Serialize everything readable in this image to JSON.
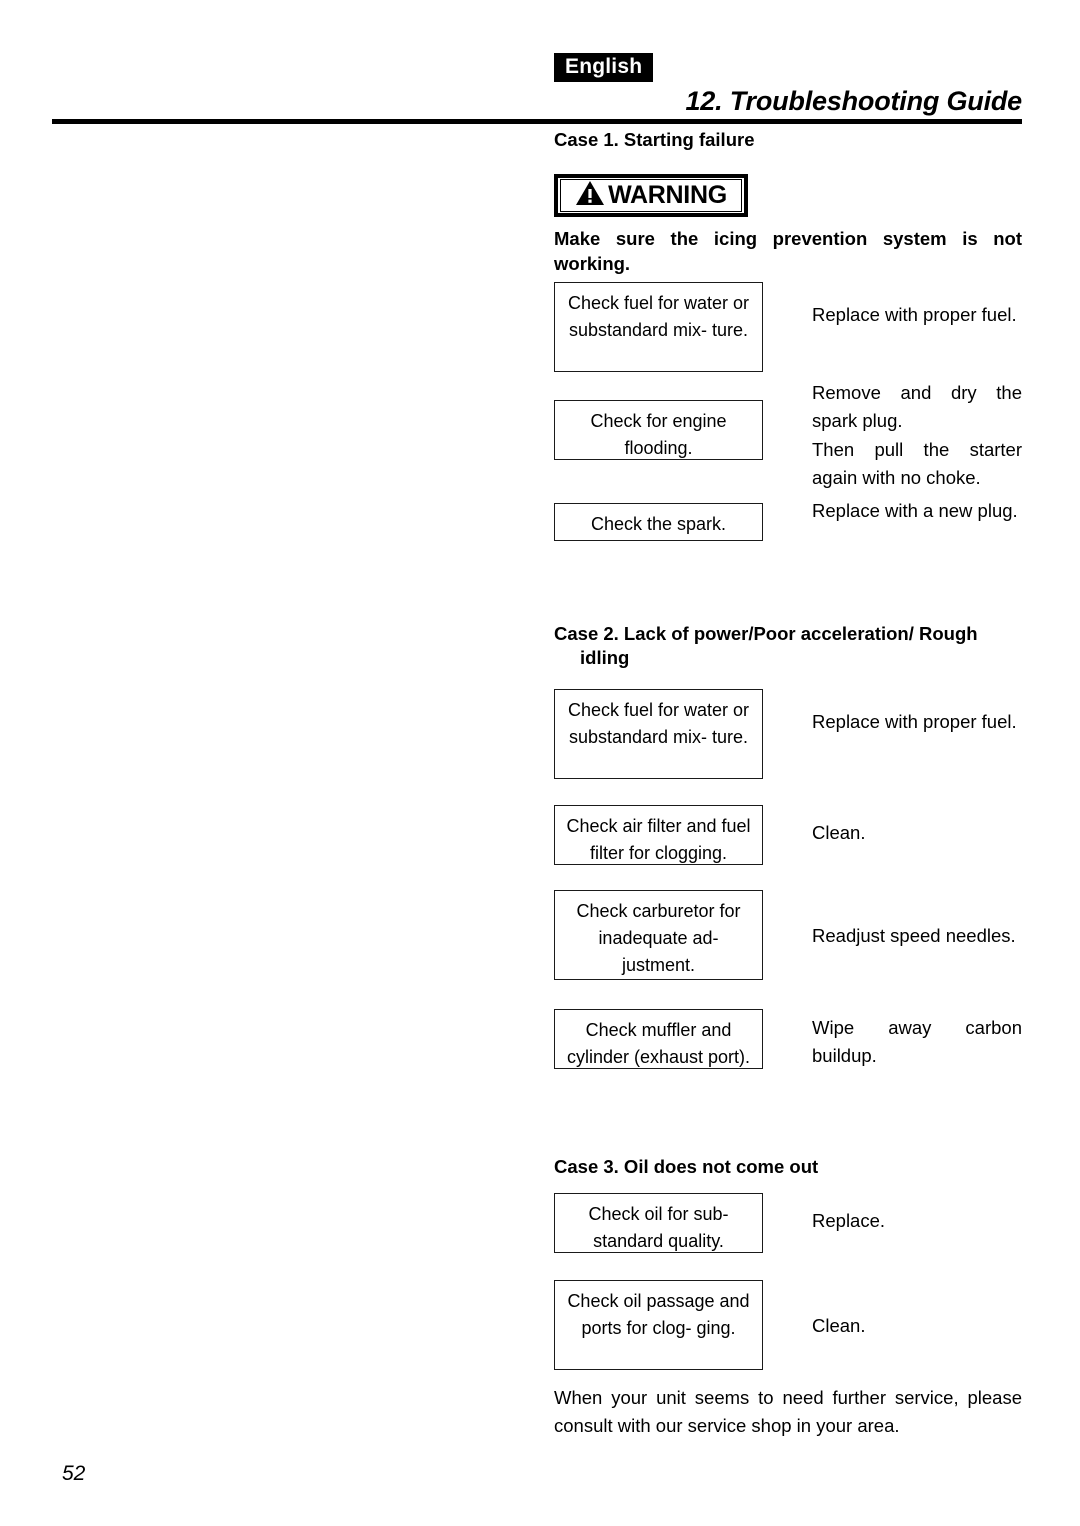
{
  "header": {
    "language_tag": "English",
    "title": "12. Troubleshooting Guide"
  },
  "warning": {
    "label": "WARNING",
    "icon": "warning-triangle-icon",
    "text": "Make sure the icing prevention system is not working."
  },
  "cases": [
    {
      "heading": "Case 1. Starting failure",
      "rows": [
        {
          "check": "Check fuel for water or substandard mix-\nture.",
          "action": "Replace with proper fuel."
        },
        {
          "check": "Check for engine flooding.",
          "action": "Remove and dry the spark plug.",
          "action2": "Then pull the starter again with no choke."
        },
        {
          "check": "Check the spark.",
          "action": "Replace with a new plug."
        }
      ]
    },
    {
      "heading": "Case 2. Lack of power/Poor acceleration/ Rough idling",
      "rows": [
        {
          "check": "Check fuel for water or substandard mix-\nture.",
          "action": "Replace with proper fuel."
        },
        {
          "check": "Check air filter and fuel filter for clogging.",
          "action": "Clean."
        },
        {
          "check": "Check carburetor for inadequate ad-\njustment.",
          "action": "Readjust speed needles."
        },
        {
          "check": "Check muffler and cylinder (exhaust port).",
          "action": "Wipe away carbon buildup."
        }
      ]
    },
    {
      "heading": "Case 3. Oil does not come out",
      "rows": [
        {
          "check": "Check oil for sub-\nstandard quality.",
          "action": "Replace."
        },
        {
          "check": "Check oil passage and ports for clog-\nging.",
          "action": "Clean."
        }
      ]
    }
  ],
  "closing_note": "When your unit seems to need further service, please consult with our service shop in your area.",
  "page_number": "52",
  "colors": {
    "ink": "#000000",
    "paper": "#ffffff",
    "rule": "#000000",
    "box_border": "#1a1a1a"
  }
}
